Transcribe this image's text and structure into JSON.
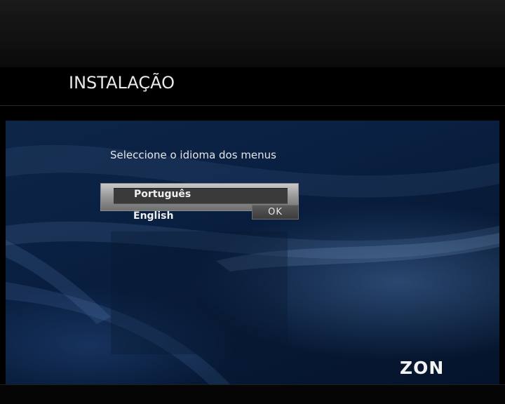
{
  "header": {
    "title": "INSTALAÇÃO"
  },
  "dialog": {
    "instruction": "Seleccione o idioma dos menus",
    "languages": [
      {
        "label": "Português",
        "selected": true
      },
      {
        "label": "English",
        "selected": false
      }
    ],
    "ok_label": "OK"
  },
  "brand": {
    "logo_text": "ZON"
  },
  "colors": {
    "background_blue": "#0a2042",
    "highlight_gray": "#9a9a9a",
    "text": "#f0f0f0"
  }
}
